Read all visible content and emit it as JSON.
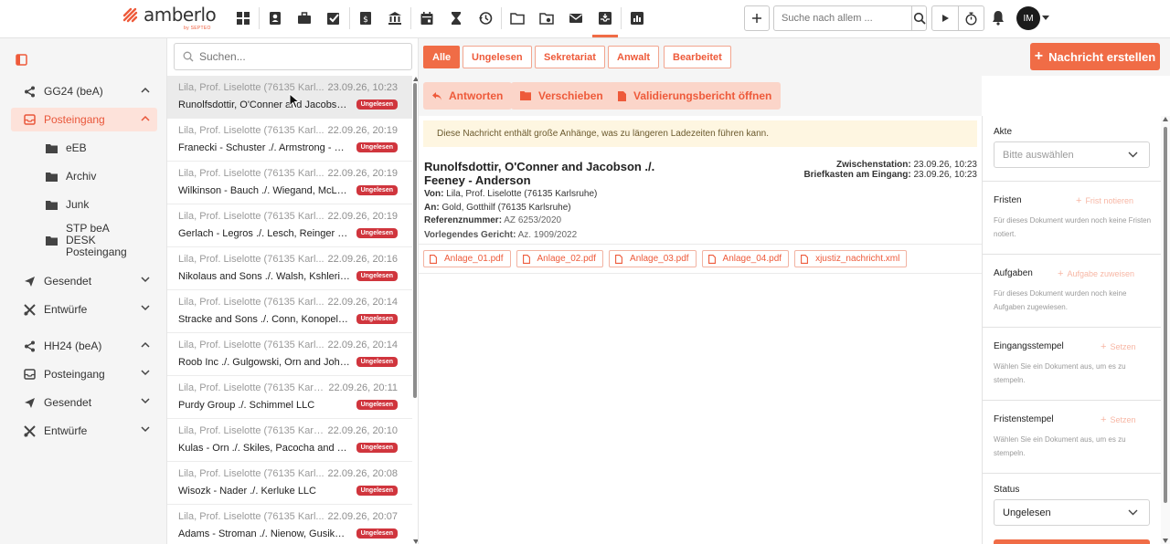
{
  "brand": {
    "name": "amberlo",
    "sub": "by SEPTEO"
  },
  "topbar": {
    "nav_icons": [
      "dashboard-icon",
      "contact-icon",
      "briefcase-icon",
      "tasks-icon",
      "billing-icon",
      "bank-icon",
      "calendar-icon",
      "hourglass-icon",
      "history-icon",
      "folder-icon",
      "folder-settings-icon",
      "mail-icon",
      "inbox-icon",
      "reports-icon"
    ],
    "active_nav": "inbox-icon",
    "search_placeholder": "Suche nach allem ...",
    "avatar_initials": "IM"
  },
  "sidebar": {
    "groups": [
      {
        "label": "GG24 (beA)",
        "expanded": true,
        "items": [
          {
            "label": "Posteingang",
            "icon": "inbox-icon",
            "active": true,
            "expanded": true
          },
          {
            "label": "eEB",
            "icon": "folder-icon",
            "sub": true
          },
          {
            "label": "Archiv",
            "icon": "folder-icon",
            "sub": true
          },
          {
            "label": "Junk",
            "icon": "folder-icon",
            "sub": true
          },
          {
            "label": "STP beA\nDESK\nPosteingang",
            "icon": "folder-icon",
            "sub": true
          },
          {
            "label": "Gesendet",
            "icon": "send-icon"
          },
          {
            "label": "Entwürfe",
            "icon": "drafts-icon"
          }
        ]
      },
      {
        "label": "HH24 (beA)",
        "expanded": true,
        "items": [
          {
            "label": "Posteingang",
            "icon": "inbox-icon"
          },
          {
            "label": "Gesendet",
            "icon": "send-icon"
          },
          {
            "label": "Entwürfe",
            "icon": "drafts-icon"
          }
        ]
      }
    ]
  },
  "message_list": {
    "search_placeholder": "Suchen...",
    "badge_label": "Ungelesen",
    "items": [
      {
        "sender": "Lila, Prof. Liselotte (76135 Karl...",
        "date": "23.09.26, 10:23",
        "subject": "Runolfsdottir, O'Conner and Jacobson ...",
        "selected": true
      },
      {
        "sender": "Lila, Prof. Liselotte (76135 Karl...",
        "date": "22.09.26, 20:19",
        "subject": "Franecki - Schuster ./. Armstrong - Harris"
      },
      {
        "sender": "Lila, Prof. Liselotte (76135 Karl...",
        "date": "22.09.26, 20:19",
        "subject": "Wilkinson - Bauch ./. Wiegand, McLaug..."
      },
      {
        "sender": "Lila, Prof. Liselotte (76135 Karl...",
        "date": "22.09.26, 20:19",
        "subject": "Gerlach - Legros ./. Lesch, Reinger and ..."
      },
      {
        "sender": "Lila, Prof. Liselotte (76135 Karl...",
        "date": "22.09.26, 20:16",
        "subject": "Nikolaus and Sons ./. Walsh, Kshlerin a..."
      },
      {
        "sender": "Lila, Prof. Liselotte (76135 Karl...",
        "date": "22.09.26, 20:14",
        "subject": "Stracke and Sons ./. Conn, Konopelski ..."
      },
      {
        "sender": "Lila, Prof. Liselotte (76135 Karl...",
        "date": "22.09.26, 20:14",
        "subject": "Roob Inc ./. Gulgowski, Orn and Johnson"
      },
      {
        "sender": "Lila, Prof. Liselotte (76135 Karls...",
        "date": "22.09.26, 20:11",
        "subject": "Purdy Group ./. Schimmel LLC"
      },
      {
        "sender": "Lila, Prof. Liselotte (76135 Karls...",
        "date": "22.09.26, 20:10",
        "subject": "Kulas - Orn ./. Skiles, Pacocha and Chri..."
      },
      {
        "sender": "Lila, Prof. Liselotte (76135 Karl...",
        "date": "22.09.26, 20:08",
        "subject": "Wisozk - Nader ./. Kerluke LLC"
      },
      {
        "sender": "Lila, Prof. Liselotte (76135 Karl...",
        "date": "22.09.26, 20:07",
        "subject": "Adams - Stroman ./. Nienow, Gusikows..."
      }
    ]
  },
  "filters": [
    "Alle",
    "Ungelesen",
    "Sekretariat",
    "Anwalt",
    "Bearbeitet"
  ],
  "active_filter": "Alle",
  "create_button": "Nachricht erstellen",
  "actions": {
    "reply": "Antworten",
    "move": "Verschieben",
    "validation": "Validierungsbericht öffnen"
  },
  "message": {
    "notice": "Diese Nachricht enthält große Anhänge, was zu längeren Ladezeiten führen kann.",
    "title": "Runolfsdottir, O'Conner and Jacobson ./. Feeney - Anderson",
    "zwischenstation_label": "Zwischenstation:",
    "zwischenstation_value": "23.09.26, 10:23",
    "briefkasten_label": "Briefkasten am Eingang:",
    "briefkasten_value": "23.09.26, 10:23",
    "von_label": "Von:",
    "von_value": "Lila, Prof. Liselotte (76135 Karlsruhe)",
    "an_label": "An:",
    "an_value": "Gold, Gotthilf (76135 Karlsruhe)",
    "ref_label": "Referenznummer:",
    "ref_value": "AZ 6253/2020",
    "court_label": "Vorlegendes Gericht:",
    "court_value": "Az. 1909/2022",
    "attachments": [
      "Anlage_01.pdf",
      "Anlage_02.pdf",
      "Anlage_03.pdf",
      "Anlage_04.pdf",
      "xjustiz_nachricht.xml"
    ]
  },
  "right_panel": {
    "akte_label": "Akte",
    "akte_placeholder": "Bitte auswählen",
    "fristen_label": "Fristen",
    "fristen_link": "Frist notieren",
    "fristen_desc": "Für dieses Dokument wurden noch keine Fristen notiert.",
    "aufgaben_label": "Aufgaben",
    "aufgaben_link": "Aufgabe zuweisen",
    "aufgaben_desc": "Für dieses Dokument wurden noch keine Aufgaben zugewiesen.",
    "eingang_label": "Eingangsstempel",
    "eingang_link": "Setzen",
    "eingang_desc": "Wählen Sie ein Dokument aus, um es zu stempeln.",
    "fristenstempel_label": "Fristenstempel",
    "fristenstempel_link": "Setzen",
    "fristenstempel_desc": "Wählen Sie ein Dokument aus, um es zu stempeln.",
    "status_label": "Status",
    "status_value": "Ungelesen"
  },
  "colors": {
    "accent": "#f06c46",
    "badge": "#d0353d",
    "notice_bg": "#fef6e1"
  }
}
